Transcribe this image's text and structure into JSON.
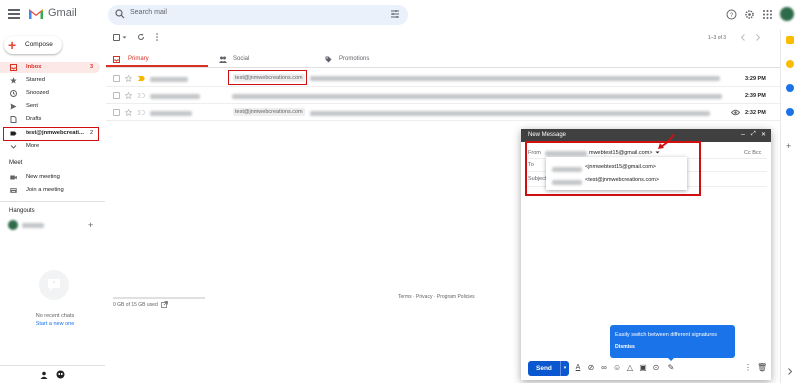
{
  "app": {
    "name": "Gmail"
  },
  "search": {
    "placeholder": "Search mail"
  },
  "sidebar": {
    "compose_label": "Compose",
    "items": [
      {
        "label": "Inbox",
        "count": "3"
      },
      {
        "label": "Starred",
        "count": ""
      },
      {
        "label": "Snoozed",
        "count": ""
      },
      {
        "label": "Sent",
        "count": ""
      },
      {
        "label": "Drafts",
        "count": ""
      },
      {
        "label": "test@jnmwebcreati...",
        "count": "2"
      },
      {
        "label": "More",
        "count": ""
      }
    ],
    "meet_title": "Meet",
    "meet_items": [
      "New meeting",
      "Join a meeting"
    ],
    "hangouts_title": "Hangouts",
    "no_chats": "No recent chats",
    "start_new": "Start a new one"
  },
  "toolbar": {
    "pagination": "1–3 of 3"
  },
  "tabs": [
    {
      "label": "Primary"
    },
    {
      "label": "Social"
    },
    {
      "label": "Promotions"
    }
  ],
  "emails": [
    {
      "label": "test@jnmwebcreations.com",
      "time": "3:29 PM",
      "bold": true
    },
    {
      "label": "",
      "time": "2:39 PM",
      "bold": false
    },
    {
      "label": "test@jnmwebcreations.com",
      "time": "2:32 PM",
      "bold": false
    }
  ],
  "footer": {
    "storage": "0 GB of 15 GB used",
    "links": "Terms · Privacy · Program Policies"
  },
  "compose_window": {
    "title": "New Message",
    "from_label": "From",
    "from_value": "mwebtest15@gmail.com>",
    "to_label": "To",
    "subject_label": "Subject",
    "cc_bcc": "Cc Bcc",
    "dropdown_options": [
      "<jnmwebtest15@gmail.com>",
      "<test@jnmwebcreations.com>"
    ],
    "tooltip_text": "Easily switch between different signatures",
    "tooltip_dismiss": "Dismiss",
    "send_label": "Send"
  },
  "colors": {
    "accent_red": "#d93025",
    "highlight_red": "#d01010",
    "send_blue": "#0b57d0",
    "tooltip_blue": "#1a73e8"
  }
}
